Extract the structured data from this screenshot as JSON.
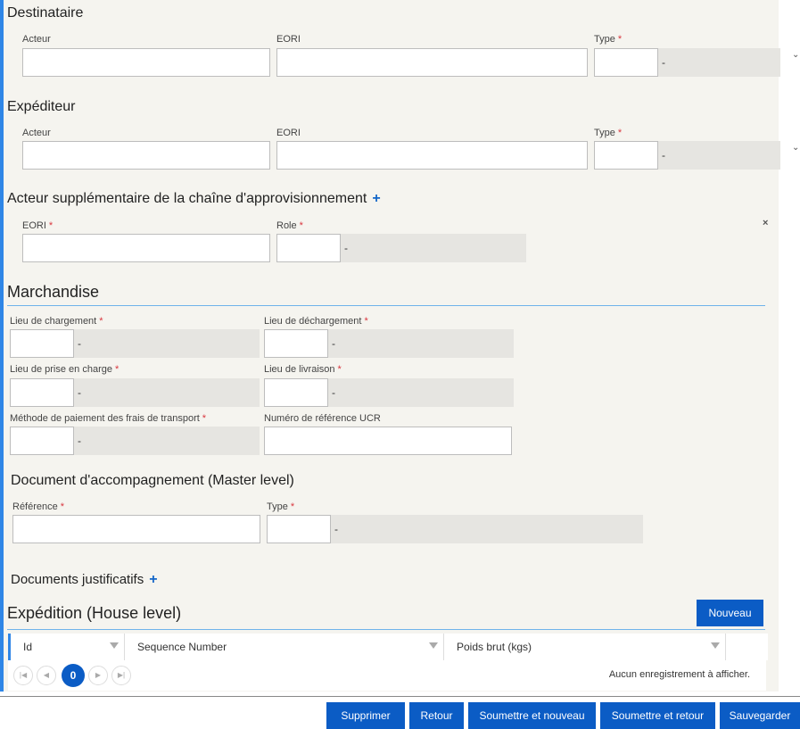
{
  "destinataire": {
    "title": "Destinataire",
    "acteur_label": "Acteur",
    "eori_label": "EORI",
    "type_label": "Type",
    "type_value": "-"
  },
  "expediteur": {
    "title": "Expéditeur",
    "acteur_label": "Acteur",
    "eori_label": "EORI",
    "type_label": "Type",
    "type_value": "-"
  },
  "supply_chain": {
    "title": "Acteur supplémentaire de la chaîne d'approvisionnement",
    "plus": "+",
    "eori_label": "EORI",
    "role_label": "Role",
    "role_value": "-",
    "remove": "×"
  },
  "marchandise": {
    "title": "Marchandise",
    "lieu_chargement_label": "Lieu de chargement",
    "lieu_chargement_value": "-",
    "lieu_dechargement_label": "Lieu de déchargement",
    "lieu_dechargement_value": "-",
    "lieu_prise_label": "Lieu de prise en charge",
    "lieu_prise_value": "-",
    "lieu_livraison_label": "Lieu de livraison",
    "lieu_livraison_value": "-",
    "methode_paiement_label": "Méthode de paiement des frais de transport",
    "methode_paiement_value": "-",
    "ucr_label": "Numéro de référence UCR"
  },
  "document_accompagnement": {
    "title": "Document d'accompagnement (Master level)",
    "reference_label": "Référence",
    "type_label": "Type",
    "type_value": "-"
  },
  "documents_justificatifs": {
    "title": "Documents justificatifs",
    "plus": "+"
  },
  "expedition": {
    "title": "Expédition (House level)",
    "new_button": "Nouveau",
    "columns": [
      "Id",
      "Sequence Number",
      "Poids brut (kgs)"
    ],
    "current_page": "0",
    "empty_message": "Aucun enregistrement à afficher."
  },
  "required_mark": "*",
  "footer_buttons": {
    "supprimer": "Supprimer",
    "retour": "Retour",
    "soumettre_nouveau": "Soumettre et nouveau",
    "soumettre_retour": "Soumettre et retour",
    "sauvegarder": "Sauvegarder"
  },
  "colors": {
    "accent": "#2f86e6",
    "button": "#0b5cc5",
    "required": "#d9363e",
    "panel_bg": "#f5f4ef",
    "readonly_bg": "#e6e5e1"
  },
  "icons": {
    "chevron": "chevron-down-icon",
    "close": "close-icon",
    "filter": "filter-icon",
    "pager_first": "first-page-icon",
    "pager_prev": "previous-page-icon",
    "pager_next": "next-page-icon",
    "pager_last": "last-page-icon"
  }
}
